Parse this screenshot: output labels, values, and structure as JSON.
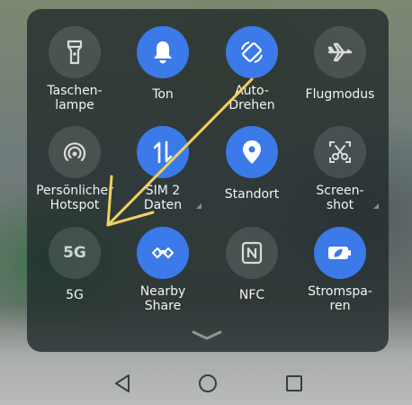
{
  "quick_settings": {
    "tiles": [
      {
        "key": "flashlight",
        "label": "Taschen-\nlampe",
        "active": false,
        "icon": "flashlight-icon"
      },
      {
        "key": "sound",
        "label": "Ton",
        "active": true,
        "icon": "bell-icon"
      },
      {
        "key": "autorotate",
        "label": "Auto-\nDrehen",
        "active": true,
        "icon": "rotate-icon"
      },
      {
        "key": "airplane",
        "label": "Flugmodus",
        "active": false,
        "icon": "airplane-icon"
      },
      {
        "key": "hotspot",
        "label": "Persönlicher\nHotspot",
        "active": false,
        "icon": "hotspot-icon"
      },
      {
        "key": "mobiledata",
        "label": "SIM 2\nDaten",
        "active": true,
        "icon": "data-arrows-icon"
      },
      {
        "key": "location",
        "label": "Standort",
        "active": true,
        "icon": "location-pin-icon"
      },
      {
        "key": "screenshot",
        "label": "Screen-\nshot",
        "active": false,
        "icon": "scissors-icon"
      },
      {
        "key": "fiveg",
        "label": "5G",
        "active": false,
        "icon": "5g-icon",
        "icon_text": "5G"
      },
      {
        "key": "nearby",
        "label": "Nearby\nShare",
        "active": true,
        "icon": "nearby-share-icon"
      },
      {
        "key": "nfc",
        "label": "NFC",
        "active": false,
        "icon": "nfc-icon"
      },
      {
        "key": "powersave",
        "label": "Stromspa-\nren",
        "active": true,
        "icon": "battery-leaf-icon"
      }
    ]
  },
  "colors": {
    "active": "#3b7ae8",
    "annotation_arrow": "#f0d060"
  },
  "nav": {
    "back": "back-triangle-icon",
    "home": "home-circle-icon",
    "recents": "recents-square-icon"
  }
}
